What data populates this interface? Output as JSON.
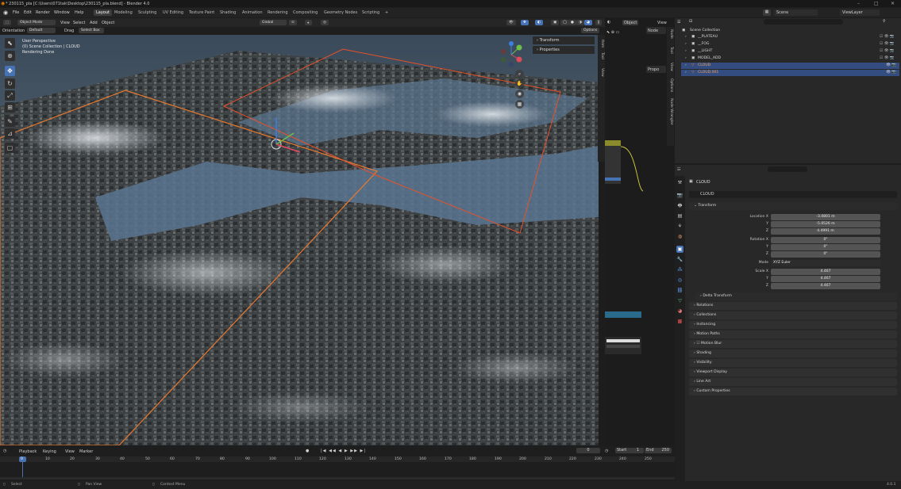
{
  "app": {
    "title": "* 230115_pla [C:\\Users\\071tak\\Desktop\\230115_pla.blend] - Blender 4.0",
    "version": "4.0.1"
  },
  "menus": [
    "File",
    "Edit",
    "Render",
    "Window",
    "Help"
  ],
  "workspaces": [
    {
      "label": "Layout",
      "active": true
    },
    {
      "label": "Modeling",
      "active": false
    },
    {
      "label": "Sculpting",
      "active": false
    },
    {
      "label": "UV Editing",
      "active": false
    },
    {
      "label": "Texture Paint",
      "active": false
    },
    {
      "label": "Shading",
      "active": false
    },
    {
      "label": "Animation",
      "active": false
    },
    {
      "label": "Rendering",
      "active": false
    },
    {
      "label": "Compositing",
      "active": false
    },
    {
      "label": "Geometry Nodes",
      "active": false
    },
    {
      "label": "Scripting",
      "active": false
    }
  ],
  "scene": {
    "label": "Scene",
    "view_layer": "ViewLayer"
  },
  "viewport_header": {
    "mode": "Object Mode",
    "menus": [
      "View",
      "Select",
      "Add",
      "Object"
    ],
    "transform": "Global",
    "options": "Options"
  },
  "viewport_header2": {
    "orientation_label": "Orientation",
    "orientation_value": "Default",
    "drag_label": "Drag",
    "drag_value": "Select Box"
  },
  "viewport_overlay": {
    "line1": "User Perspective",
    "line2": "(0) Scene Collection | CLOUD",
    "line3": "Rendering Done"
  },
  "npanel": {
    "transform": "Transform",
    "properties": "Properties"
  },
  "viewport_tabs": [
    "Item",
    "Tool",
    "View"
  ],
  "node_editor": {
    "header_object": "Object",
    "header_view": "View",
    "nodes_label": "Node",
    "prop_label": "Propo",
    "tabs": [
      "Node",
      "Tool",
      "View",
      "Options",
      "Node Wrangler"
    ]
  },
  "outliner": {
    "search_placeholder": "",
    "root": "Scene Collection",
    "items": [
      {
        "name": "__PLATEAU",
        "selected": false
      },
      {
        "name": "__FOG",
        "selected": false
      },
      {
        "name": "__LIGHT",
        "selected": false
      },
      {
        "name": "MODEL_ADD",
        "selected": false
      },
      {
        "name": "CLOUD",
        "selected": true
      },
      {
        "name": "CLOUD.001",
        "selected": true
      }
    ]
  },
  "properties": {
    "object_name": "CLOUD",
    "object_field": "CLOUD",
    "transform_section": "Transform",
    "location": {
      "label_x": "Location X",
      "x": "-3.0801 m",
      "y": "-5.0526 m",
      "z": "4.4991 m"
    },
    "rotation": {
      "label_x": "Rotation X",
      "x": "0°",
      "y": "0°",
      "z": "0°"
    },
    "mode_label": "Mode",
    "mode_value": "XYZ Euler",
    "scale": {
      "label_x": "Scale X",
      "x": "4.467",
      "y": "4.467",
      "z": "4.467"
    },
    "axis_y": "Y",
    "axis_z": "Z",
    "delta": "Delta Transform",
    "sections": [
      "Relations",
      "Collections",
      "Instancing",
      "Motion Paths",
      "Motion Blur",
      "Shading",
      "Visibility",
      "Viewport Display",
      "Line Art",
      "Custom Properties"
    ]
  },
  "timeline": {
    "menus": [
      "Playback",
      "Keying",
      "View",
      "Marker"
    ],
    "current_frame": "0",
    "start_label": "Start",
    "start": "1",
    "end_label": "End",
    "end": "250",
    "ticks": [
      "0",
      "10",
      "20",
      "30",
      "40",
      "50",
      "60",
      "70",
      "80",
      "90",
      "100",
      "110",
      "120",
      "130",
      "140",
      "150",
      "160",
      "170",
      "180",
      "190",
      "200",
      "210",
      "220",
      "230",
      "240",
      "250"
    ]
  },
  "statusbar": {
    "select": "Select",
    "pan": "Pan View",
    "context": "Context Menu"
  }
}
